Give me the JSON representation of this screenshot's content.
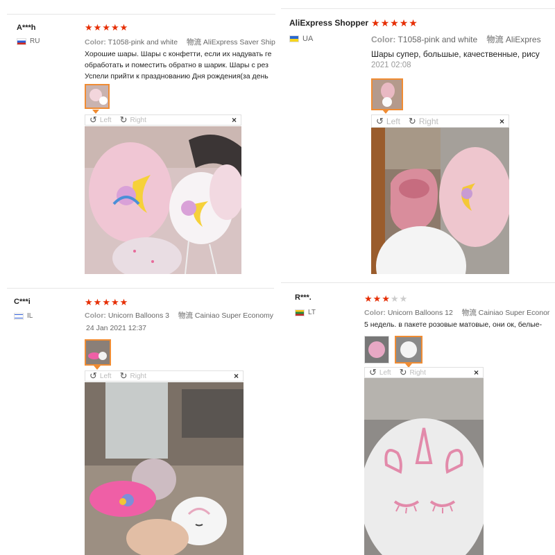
{
  "reviews": [
    {
      "user": "A***h",
      "country": "RU",
      "rating": 5,
      "color_label": "Color:",
      "color_value": "T1058-pink and white",
      "shipping_label": "物流",
      "shipping_value": "AliExpress Saver Shipp",
      "text_lines": [
        "Хорошие шары. Шары с конфетти, если их надувать ге",
        "обработать и поместить обратно в шарик. Шары с рез",
        "Успели прийти к празднованию Дня рождения(за день"
      ],
      "viewer": {
        "left": "Left",
        "right": "Right",
        "close": "×"
      }
    },
    {
      "user": "AliExpress Shopper",
      "country": "UA",
      "rating": 5,
      "color_label": "Color:",
      "color_value": "T1058-pink and white",
      "shipping_label": "物流",
      "shipping_value": "AliExpres",
      "text_lines": [
        "Шары супер, большые, качественные, рису"
      ],
      "date": "2021 02:08",
      "viewer": {
        "left": "Left",
        "right": "Right",
        "close": "×"
      }
    },
    {
      "user": "C***i",
      "country": "IL",
      "rating": 5,
      "color_label": "Color:",
      "color_value": "Unicorn Balloons 3",
      "shipping_label": "物流",
      "shipping_value": "Cainiao Super Economy",
      "date": "24 Jan 2021 12:37",
      "viewer": {
        "left": "Left",
        "right": "Right",
        "close": "×"
      }
    },
    {
      "user": "R***.",
      "country": "LT",
      "rating": 3,
      "color_label": "Color:",
      "color_value": "Unicorn Balloons 12",
      "shipping_label": "物流",
      "shipping_value": "Cainiao Super Econor",
      "text_lines": [
        "5 недель. в пакете розовые матовые, они ок, белые-"
      ],
      "viewer": {
        "left": "Left",
        "right": "Right",
        "close": "×"
      }
    }
  ],
  "icons": {
    "rotate_left": "rotate-left-icon",
    "rotate_right": "rotate-right-icon",
    "close": "close-icon",
    "star": "star-icon"
  },
  "colors": {
    "star_active": "#e62e04",
    "star_inactive": "#cccccc",
    "thumb_active_border": "#f08c33"
  }
}
